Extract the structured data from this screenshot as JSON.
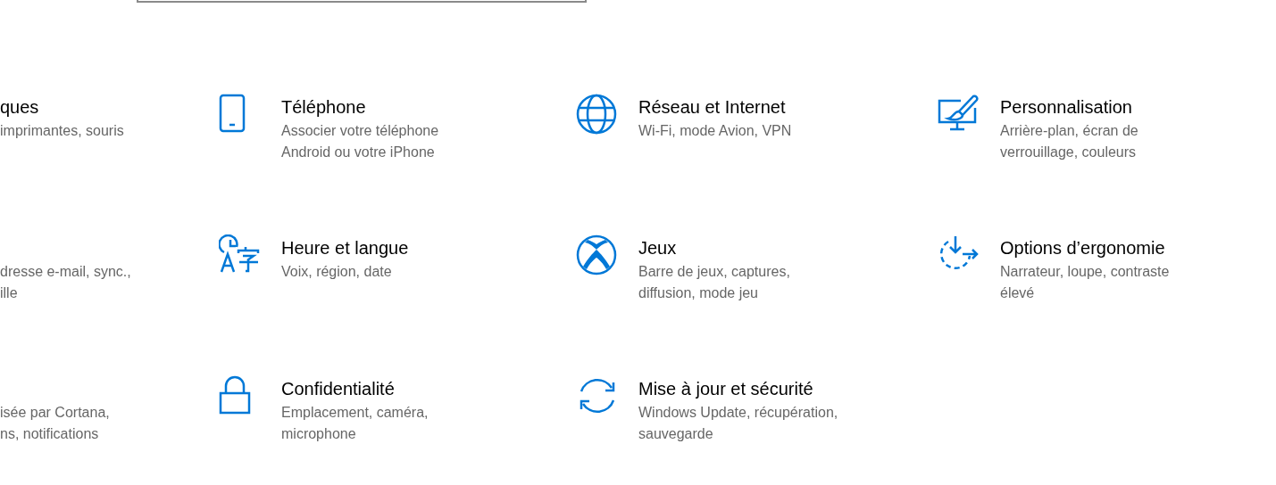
{
  "settings_grid": [
    {
      "tiles": [
        {
          "title": "ques",
          "description_lines": [
            "imprimantes, souris"
          ]
        },
        {
          "description_lines": [
            "dresse e-mail, sync.,",
            "ille"
          ]
        },
        {
          "description_lines": [
            "isée par Cortana,",
            "ns, notifications"
          ]
        }
      ]
    },
    {
      "tiles": [
        {
          "title": "Téléphone",
          "description_lines": [
            "Associer votre téléphone",
            "Android ou votre iPhone"
          ]
        },
        {
          "title": "Heure et langue",
          "description_lines": [
            "Voix, région, date"
          ]
        },
        {
          "title": "Confidentialité",
          "description_lines": [
            "Emplacement, caméra,",
            "microphone"
          ]
        }
      ]
    },
    {
      "tiles": [
        {
          "title": "Réseau et Internet",
          "description_lines": [
            "Wi-Fi, mode Avion, VPN"
          ]
        },
        {
          "title": "Jeux",
          "description_lines": [
            "Barre de jeux, captures,",
            "diffusion, mode jeu"
          ]
        },
        {
          "title": "Mise à jour et sécurité",
          "description_lines": [
            "Windows Update, récupération,",
            "sauvegarde"
          ]
        }
      ]
    },
    {
      "tiles": [
        {
          "title": "Personnalisation",
          "description_lines": [
            "Arrière-plan, écran de",
            "verrouillage, couleurs"
          ]
        },
        {
          "title": "Options d’ergonomie",
          "description_lines": [
            "Narrateur, loupe, contraste",
            "élevé"
          ]
        }
      ]
    }
  ]
}
